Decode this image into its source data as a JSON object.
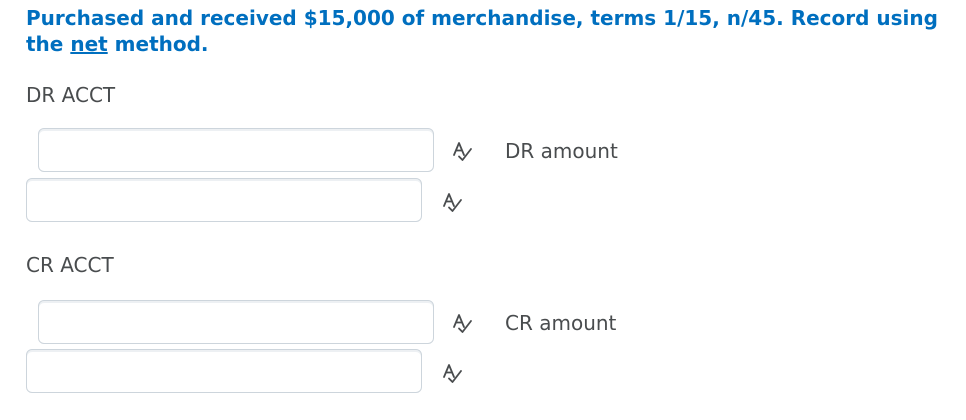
{
  "question": {
    "text_before_link": "Purchased and received $15,000 of merchandise, terms 1/15, n/45.  Record using the ",
    "link_text": "net",
    "text_after_link": " method."
  },
  "debit": {
    "section_label": "DR ACCT",
    "amount_label": "DR amount",
    "account_value": "",
    "amount_value": ""
  },
  "credit": {
    "section_label": "CR ACCT",
    "amount_label": "CR amount",
    "account_value": "",
    "amount_value": ""
  },
  "icons": {
    "spell_check": "spellcheck-icon"
  },
  "colors": {
    "question_text": "#006fbf",
    "body_text": "#494c4e",
    "field_border": "#cdd5dc"
  }
}
